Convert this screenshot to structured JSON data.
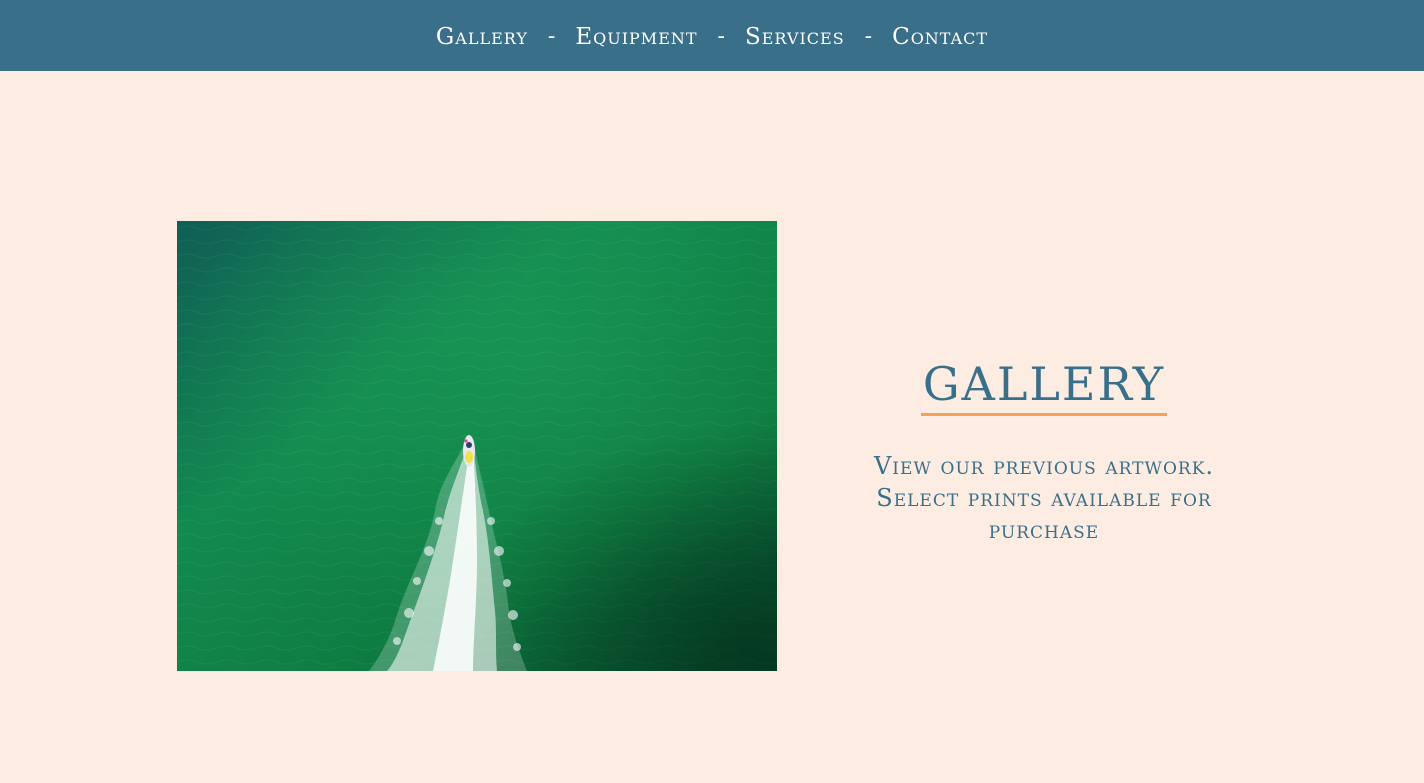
{
  "nav": {
    "items": [
      {
        "label": "Gallery"
      },
      {
        "label": "Equipment"
      },
      {
        "label": "Services"
      },
      {
        "label": "Contact"
      }
    ],
    "separator": "-"
  },
  "gallery": {
    "title": "GALLERY",
    "description": "View our previous artwork. Select prints available for purchase"
  },
  "colors": {
    "nav_background": "#3a6f8a",
    "page_background": "#fcece1",
    "accent_underline": "#f0a257",
    "heading_text": "#3a6f8a"
  }
}
